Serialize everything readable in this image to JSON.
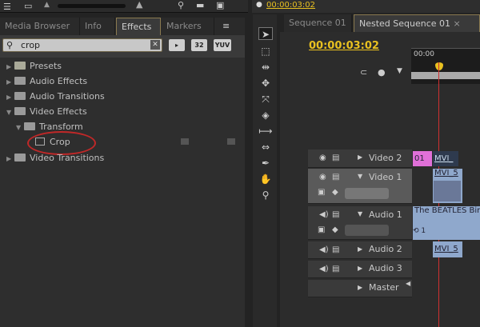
{
  "top": {
    "timecode_small": "00:00:03:02"
  },
  "effects_panel": {
    "tabs": [
      {
        "label": "Media Browser"
      },
      {
        "label": "Info"
      },
      {
        "label": "Effects",
        "active": true
      },
      {
        "label": "Markers"
      }
    ],
    "close": "×",
    "menu": "≡",
    "search": {
      "value": "crop"
    },
    "buttons": [
      "32",
      "YUV",
      "▸"
    ],
    "tree": [
      {
        "label": "Presets",
        "expanded": false,
        "level": 0
      },
      {
        "label": "Audio Effects",
        "expanded": false,
        "level": 0
      },
      {
        "label": "Audio Transitions",
        "expanded": false,
        "level": 0
      },
      {
        "label": "Video Effects",
        "expanded": true,
        "level": 0
      },
      {
        "label": "Transform",
        "expanded": true,
        "level": 1
      },
      {
        "label": "Crop",
        "level": 2
      },
      {
        "label": "Video Transitions",
        "expanded": false,
        "level": 0
      }
    ]
  },
  "sequence_panel": {
    "tabs": [
      {
        "label": "Sequence 01"
      },
      {
        "label": "Nested Sequence 01",
        "active": true
      }
    ],
    "timecode": "00:00:03:02",
    "ruler_start": "00:00",
    "tracks": [
      {
        "name": "Video 2"
      },
      {
        "name": "Video 1"
      },
      {
        "name": "Audio 1"
      },
      {
        "name": "Audio 2"
      },
      {
        "name": "Audio 3"
      },
      {
        "name": "Master"
      }
    ],
    "clips": {
      "v2a": "01",
      "v2b": "MVI_",
      "v1": "MVI_5",
      "a1": "The BEATLES Birt",
      "a1b": "⟲ 1",
      "a2": "MVI_5"
    }
  },
  "colors": {
    "accent": "#e8c020",
    "playhead": "#d03030",
    "clip_video": "#8fa8cc",
    "clip_pink": "#e070d8"
  }
}
